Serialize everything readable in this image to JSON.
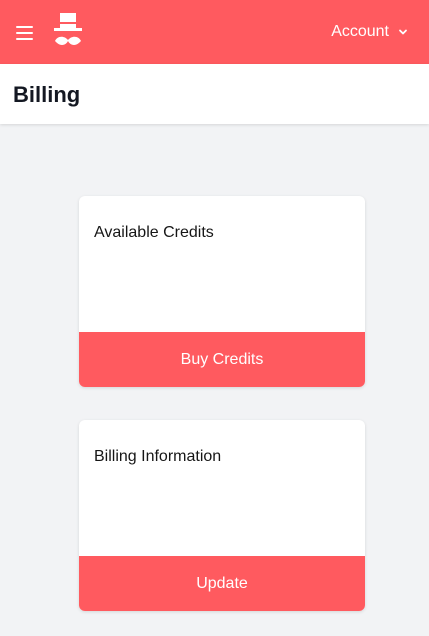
{
  "colors": {
    "brand": "#ff5a5f",
    "background": "#f2f3f5",
    "card": "#ffffff",
    "title": "#141822"
  },
  "topbar": {
    "menu_icon": "hamburger-icon",
    "logo_icon": "top-hat-mustache-logo",
    "account_label": "Account",
    "account_icon": "chevron-down-icon"
  },
  "page": {
    "title": "Billing"
  },
  "cards": [
    {
      "title": "Available Credits",
      "button_label": "Buy Credits"
    },
    {
      "title": "Billing Information",
      "button_label": "Update"
    }
  ]
}
